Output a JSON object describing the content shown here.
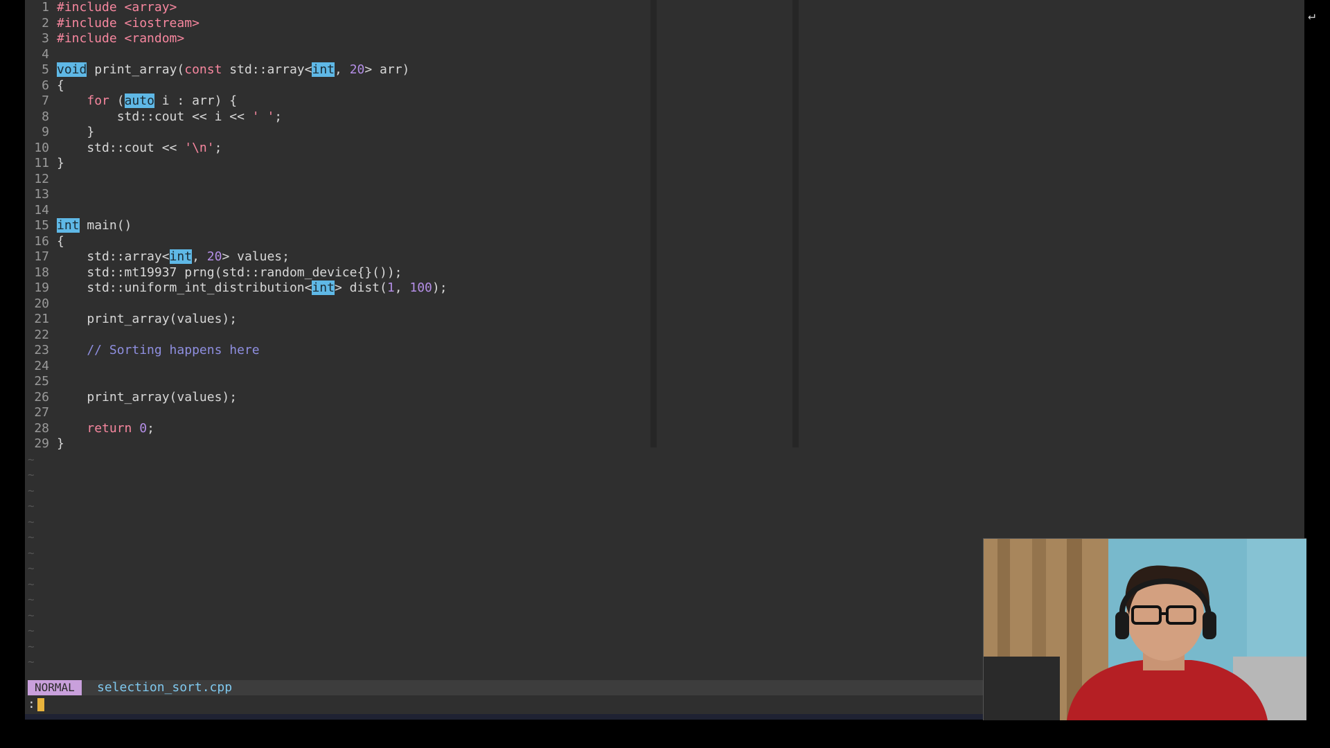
{
  "editor": {
    "mode": "NORMAL",
    "filename": "selection_sort.cpp",
    "command_prompt": ":",
    "return_icon": "↵",
    "lines": [
      {
        "n": "1",
        "tokens": [
          {
            "t": "#include <array>",
            "c": "pre"
          }
        ]
      },
      {
        "n": "2",
        "tokens": [
          {
            "t": "#include <iostream>",
            "c": "pre"
          }
        ]
      },
      {
        "n": "3",
        "tokens": [
          {
            "t": "#include <random>",
            "c": "pre"
          }
        ]
      },
      {
        "n": "4",
        "tokens": []
      },
      {
        "n": "5",
        "tokens": [
          {
            "t": "void",
            "c": "hl"
          },
          {
            "t": " print_array("
          },
          {
            "t": "const",
            "c": "kw"
          },
          {
            "t": " std::array<"
          },
          {
            "t": "int",
            "c": "hl"
          },
          {
            "t": ", "
          },
          {
            "t": "20",
            "c": "num"
          },
          {
            "t": "> arr)"
          }
        ]
      },
      {
        "n": "6",
        "tokens": [
          {
            "t": "{"
          }
        ]
      },
      {
        "n": "7",
        "tokens": [
          {
            "t": "    "
          },
          {
            "t": "for",
            "c": "kw"
          },
          {
            "t": " ("
          },
          {
            "t": "auto",
            "c": "hl"
          },
          {
            "t": " i : arr) {"
          }
        ]
      },
      {
        "n": "8",
        "tokens": [
          {
            "t": "        std::cout << i << "
          },
          {
            "t": "' '",
            "c": "str"
          },
          {
            "t": ";"
          }
        ]
      },
      {
        "n": "9",
        "tokens": [
          {
            "t": "    }"
          }
        ]
      },
      {
        "n": "10",
        "tokens": [
          {
            "t": "    std::cout << "
          },
          {
            "t": "'\\n'",
            "c": "str"
          },
          {
            "t": ";"
          }
        ]
      },
      {
        "n": "11",
        "tokens": [
          {
            "t": "}"
          }
        ]
      },
      {
        "n": "12",
        "tokens": []
      },
      {
        "n": "13",
        "tokens": []
      },
      {
        "n": "14",
        "tokens": []
      },
      {
        "n": "15",
        "tokens": [
          {
            "t": "int",
            "c": "hl"
          },
          {
            "t": " main()"
          }
        ]
      },
      {
        "n": "16",
        "tokens": [
          {
            "t": "{"
          }
        ]
      },
      {
        "n": "17",
        "tokens": [
          {
            "t": "    std::array<"
          },
          {
            "t": "int",
            "c": "hl"
          },
          {
            "t": ", "
          },
          {
            "t": "20",
            "c": "num"
          },
          {
            "t": "> values;"
          }
        ]
      },
      {
        "n": "18",
        "tokens": [
          {
            "t": "    std::mt19937 prng(std::random_device{}());"
          }
        ]
      },
      {
        "n": "19",
        "tokens": [
          {
            "t": "    std::uniform_int_distribution<"
          },
          {
            "t": "int",
            "c": "hl"
          },
          {
            "t": "> dist("
          },
          {
            "t": "1",
            "c": "num"
          },
          {
            "t": ", "
          },
          {
            "t": "100",
            "c": "num"
          },
          {
            "t": ");"
          }
        ]
      },
      {
        "n": "20",
        "tokens": []
      },
      {
        "n": "21",
        "tokens": [
          {
            "t": "    print_array(values);"
          }
        ]
      },
      {
        "n": "22",
        "tokens": []
      },
      {
        "n": "23",
        "tokens": [
          {
            "t": "    // Sorting happens here",
            "c": "cm"
          }
        ]
      },
      {
        "n": "24",
        "tokens": []
      },
      {
        "n": "25",
        "tokens": []
      },
      {
        "n": "26",
        "tokens": [
          {
            "t": "    print_array(values);"
          }
        ]
      },
      {
        "n": "27",
        "tokens": []
      },
      {
        "n": "28",
        "tokens": [
          {
            "t": "    "
          },
          {
            "t": "return",
            "c": "kw"
          },
          {
            "t": " "
          },
          {
            "t": "0",
            "c": "num"
          },
          {
            "t": ";"
          }
        ]
      },
      {
        "n": "29",
        "tokens": [
          {
            "t": "}"
          }
        ]
      }
    ],
    "tilde_glyph": "~",
    "tilde_count": 14
  },
  "colors": {
    "background": "#2f2f2f",
    "keyword": "#f7879f",
    "number": "#b48ee6",
    "comment": "#8f8fe0",
    "highlight": "#5fb8e6",
    "mode_badge": "#c9a0dc",
    "filename": "#7fc8ee",
    "cursor": "#e8b33c"
  }
}
